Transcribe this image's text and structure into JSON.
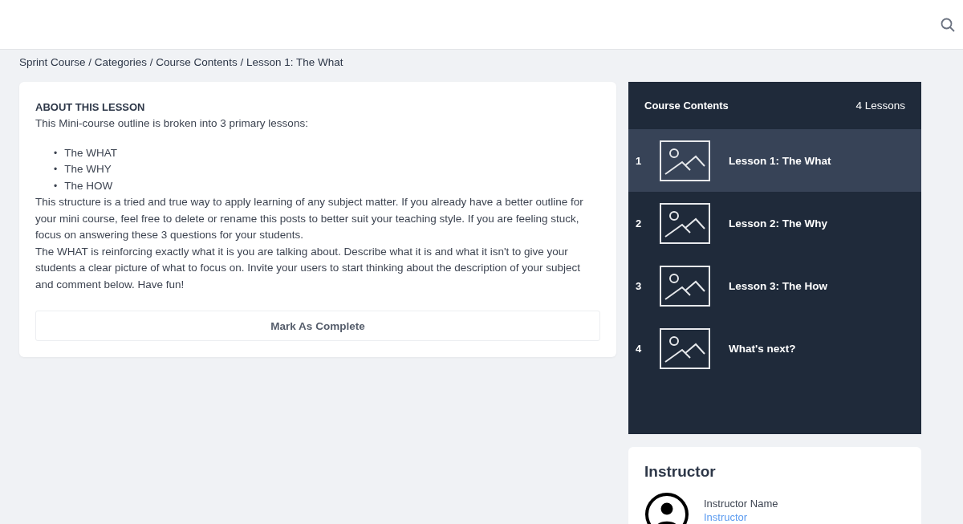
{
  "breadcrumb": "Sprint Course / Categories / Course Contents / Lesson 1: The What",
  "lesson": {
    "heading": "ABOUT THIS LESSON",
    "intro": "This Mini-course outline is broken into 3 primary lessons:",
    "bullets": [
      {
        "marker": "•",
        "text": "The WHAT"
      },
      {
        "marker": "•",
        "text": "The WHY"
      },
      {
        "marker": "•",
        "text": "The HOW"
      }
    ],
    "paragraphs": [
      "This structure is a tried and true way to apply learning of any subject matter. If you already have a better outline for your mini course, feel free to delete or rename this posts to better suit your teaching style. If you are feeling stuck, focus on answering these 3 questions for your students.",
      "The WHAT is reinforcing exactly what it is you are talking about. Describe what it is and what it isn't to give your students a clear picture of what to focus on. Invite your users to start thinking about the description of your subject and comment below. Have fun!"
    ],
    "button": "Mark As Complete"
  },
  "course_contents": {
    "title": "Course Contents",
    "count": "4 Lessons",
    "lessons": [
      {
        "number": "1",
        "title": "Lesson 1: The What",
        "selected": true
      },
      {
        "number": "2",
        "title": "Lesson 2: The Why",
        "selected": false
      },
      {
        "number": "3",
        "title": "Lesson 3: The How",
        "selected": false
      },
      {
        "number": "4",
        "title": "What's next?",
        "selected": false
      }
    ]
  },
  "instructor": {
    "title": "Instructor",
    "name": "Instructor Name",
    "role": "Instructor"
  }
}
